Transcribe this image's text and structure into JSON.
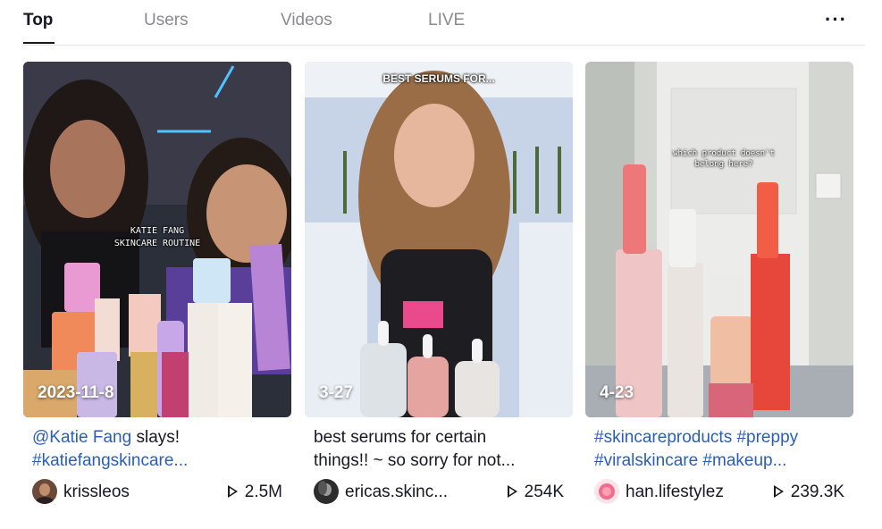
{
  "tabs": [
    {
      "label": "Top",
      "active": true
    },
    {
      "label": "Users",
      "active": false
    },
    {
      "label": "Videos",
      "active": false
    },
    {
      "label": "LIVE",
      "active": false
    }
  ],
  "more_icon": "more-horizontal-icon",
  "more_label": "···",
  "videos": [
    {
      "date": "2023-11-8",
      "caption_lines": [
        "KATIE FANG",
        "SKINCARE ROUTINE"
      ],
      "desc_line1_mention": "@Katie Fang",
      "desc_line1_rest": " slays!",
      "desc_line2_tag": "#katiefangskincare...",
      "author": "krissleos",
      "views": "2.5M"
    },
    {
      "date": "3-27",
      "caption_lines": [
        "BEST SERUMS FOR..."
      ],
      "desc_line1": "best serums for certain",
      "desc_line2": "things!! ~ so sorry for not...",
      "author": "ericas.skinc...",
      "views": "254K"
    },
    {
      "date": "4-23",
      "caption_lines": [
        "which product doesn't",
        "belong here?"
      ],
      "desc_line1_tags": "#skincareproducts #preppy",
      "desc_line2_tags": "#viralskincare #makeup...",
      "author": "han.lifestylez",
      "views": "239.3K"
    }
  ],
  "colors": {
    "tag": "#2b5db9",
    "text": "#161823",
    "muted": "#8a8b91"
  }
}
